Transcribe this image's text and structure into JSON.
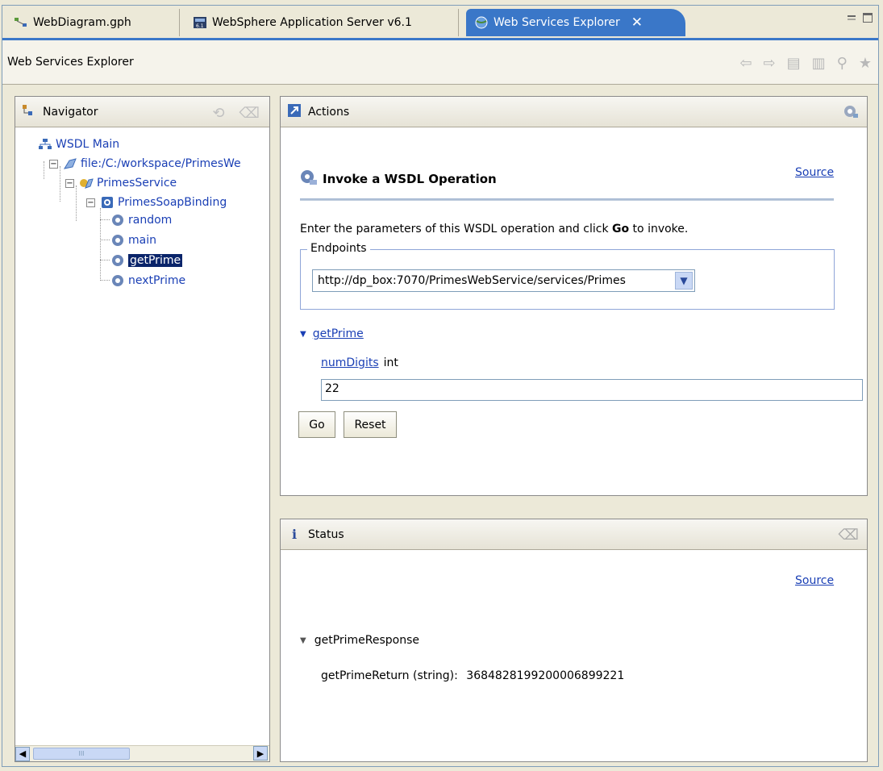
{
  "tabs": [
    {
      "label": "WebDiagram.gph",
      "icon": "diagram-icon",
      "active": false
    },
    {
      "label": "WebSphere Application Server v6.1",
      "icon": "server-icon",
      "active": false
    },
    {
      "label": "Web Services Explorer",
      "icon": "globe-icon",
      "active": true
    }
  ],
  "titlebar": {
    "title": "Web Services Explorer"
  },
  "navigator": {
    "title": "Navigator",
    "tree": [
      {
        "label": "WSDL Main",
        "icon": "wsdl-main-icon"
      },
      {
        "label": "file:/C:/workspace/PrimesWe",
        "icon": "wsdl-file-icon"
      },
      {
        "label": "PrimesService",
        "icon": "service-icon"
      },
      {
        "label": "PrimesSoapBinding",
        "icon": "binding-icon"
      },
      {
        "label": "random",
        "icon": "operation-icon"
      },
      {
        "label": "main",
        "icon": "operation-icon"
      },
      {
        "label": "getPrime",
        "icon": "operation-icon",
        "selected": true
      },
      {
        "label": "nextPrime",
        "icon": "operation-icon"
      }
    ],
    "scrollbar_thumb": "III"
  },
  "actions": {
    "title": "Actions",
    "operation_title": "Invoke a WSDL Operation",
    "source_link": "Source",
    "instruction_prefix": "Enter the parameters of this WSDL operation and click ",
    "instruction_bold": "Go",
    "instruction_suffix": " to invoke.",
    "endpoints_legend": "Endpoints",
    "endpoint_value": "http://dp_box:7070/PrimesWebService/services/Primes",
    "operation_name": "getPrime",
    "param_name": "numDigits",
    "param_type": "int",
    "param_value": "22",
    "go_label": "Go",
    "reset_label": "Reset"
  },
  "status": {
    "title": "Status",
    "source_link": "Source",
    "response_name": "getPrimeResponse",
    "return_label": "getPrimeReturn (string):",
    "return_value": "3684828199200006899221"
  }
}
